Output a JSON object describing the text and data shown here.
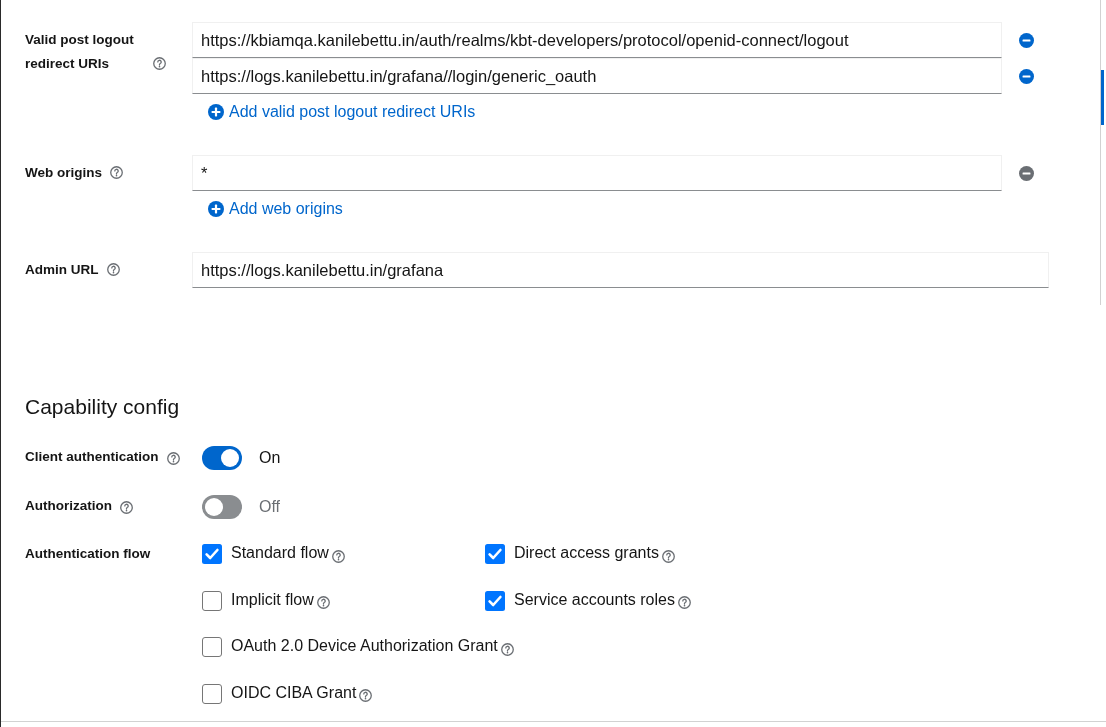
{
  "url_fields": [
    {
      "kind": "list",
      "label": "Valid post logout redirect URIs",
      "values": [
        {
          "value": "https://kbiamqa.kanilebettu.in/auth/realms/kbt-developers/protocol/openid-connect/logout",
          "remove_disabled": false
        },
        {
          "value": "https://logs.kanilebettu.in/grafana//login/generic_oauth",
          "remove_disabled": false
        }
      ],
      "add_link": "Add valid post logout redirect URIs"
    },
    {
      "kind": "list",
      "label": "Web origins",
      "values": [
        {
          "value": "*",
          "remove_disabled": true
        }
      ],
      "add_link": "Add web origins"
    },
    {
      "kind": "single",
      "label": "Admin URL",
      "value": "https://logs.kanilebettu.in/grafana"
    }
  ],
  "capability_config": {
    "title": "Capability config",
    "switches": [
      {
        "label": "Client authentication",
        "on": true,
        "state_text": "On"
      },
      {
        "label": "Authorization",
        "on": false,
        "state_text": "Off"
      }
    ],
    "authentication_flow": {
      "label": "Authentication flow",
      "columns": [
        {
          "options": [
            {
              "label": "Standard flow",
              "checked": true
            },
            {
              "label": "Implicit flow",
              "checked": false
            },
            {
              "label": "OAuth 2.0 Device Authorization Grant",
              "checked": false
            },
            {
              "label": "OIDC CIBA Grant",
              "checked": false
            }
          ]
        },
        {
          "options": [
            {
              "label": "Direct access grants",
              "checked": true
            },
            {
              "label": "Service accounts roles",
              "checked": true
            }
          ]
        }
      ]
    }
  }
}
